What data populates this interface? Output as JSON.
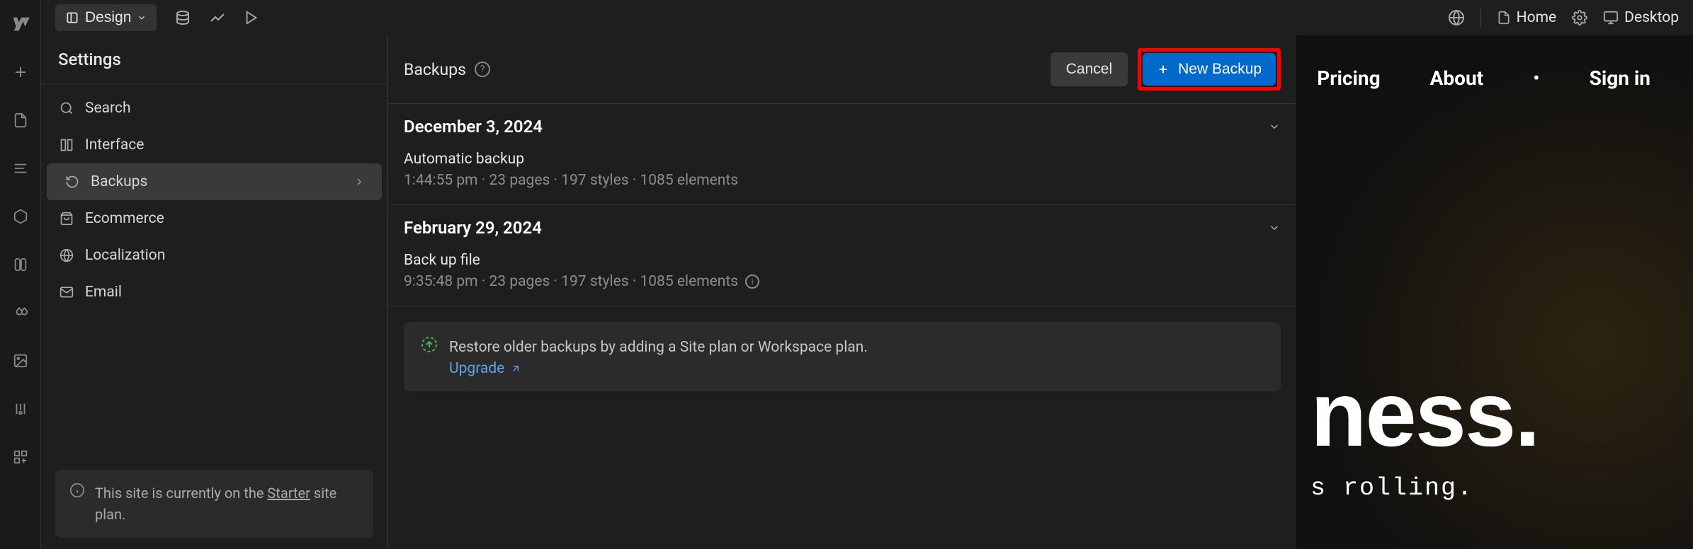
{
  "topbar": {
    "design_label": "Design",
    "home_label": "Home",
    "desktop_label": "Desktop"
  },
  "settings": {
    "title": "Settings",
    "items": [
      {
        "label": "Search",
        "icon": "search"
      },
      {
        "label": "Interface",
        "icon": "interface"
      },
      {
        "label": "Backups",
        "icon": "backup",
        "active": true
      },
      {
        "label": "Ecommerce",
        "icon": "cart"
      },
      {
        "label": "Localization",
        "icon": "globe"
      },
      {
        "label": "Email",
        "icon": "mail"
      }
    ],
    "notice_prefix": "This site is currently on the ",
    "notice_plan": "Starter",
    "notice_suffix": " site plan."
  },
  "backups": {
    "title": "Backups",
    "cancel_label": "Cancel",
    "new_label": "New Backup",
    "groups": [
      {
        "date": "December 3, 2024",
        "name": "Automatic backup",
        "meta": "1:44:55 pm · 23 pages · 197 styles · 1085 elements"
      },
      {
        "date": "February 29, 2024",
        "name": "Back up file",
        "meta": "9:35:48 pm · 23 pages · 197 styles · 1085 elements",
        "has_info": true
      }
    ],
    "upgrade_text": "Restore older backups by adding a Site plan or Workspace plan.",
    "upgrade_link": "Upgrade"
  },
  "canvas": {
    "nav": [
      "Pricing",
      "About"
    ],
    "signin": "Sign in",
    "hero_fragment": "ness.",
    "sub_fragment": "s rolling."
  }
}
